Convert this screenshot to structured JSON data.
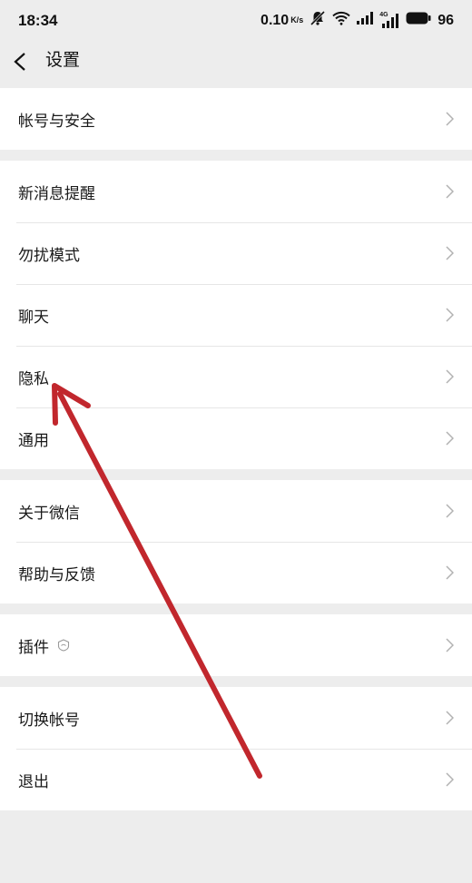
{
  "status_bar": {
    "time": "18:34",
    "net_speed": "0.10",
    "net_unit": "K/s",
    "signal_label": "4G",
    "battery": "96",
    "icons": [
      "mute-icon",
      "wifi-icon",
      "signal-icon",
      "signal-4g-icon",
      "battery-icon"
    ]
  },
  "nav": {
    "back_icon": "chevron-left-icon",
    "title": "设置"
  },
  "groups": [
    {
      "items": [
        {
          "label": "帐号与安全"
        }
      ]
    },
    {
      "items": [
        {
          "label": "新消息提醒"
        },
        {
          "label": "勿扰模式"
        },
        {
          "label": "聊天"
        },
        {
          "label": "隐私"
        },
        {
          "label": "通用"
        }
      ]
    },
    {
      "items": [
        {
          "label": "关于微信"
        },
        {
          "label": "帮助与反馈"
        }
      ]
    },
    {
      "items": [
        {
          "label": "插件",
          "icon": "plugin-shield-icon"
        }
      ]
    },
    {
      "items": [
        {
          "label": "切换帐号"
        },
        {
          "label": "退出"
        }
      ]
    }
  ],
  "row_icon": "chevron-right-icon",
  "annotation": {
    "icon": "red-arrow",
    "color": "#c1272d"
  },
  "colors": {
    "background": "#ededed",
    "row": "#ffffff",
    "text": "#191919",
    "chevron": "#b2b2b2",
    "separator": "#e6e6e6"
  }
}
